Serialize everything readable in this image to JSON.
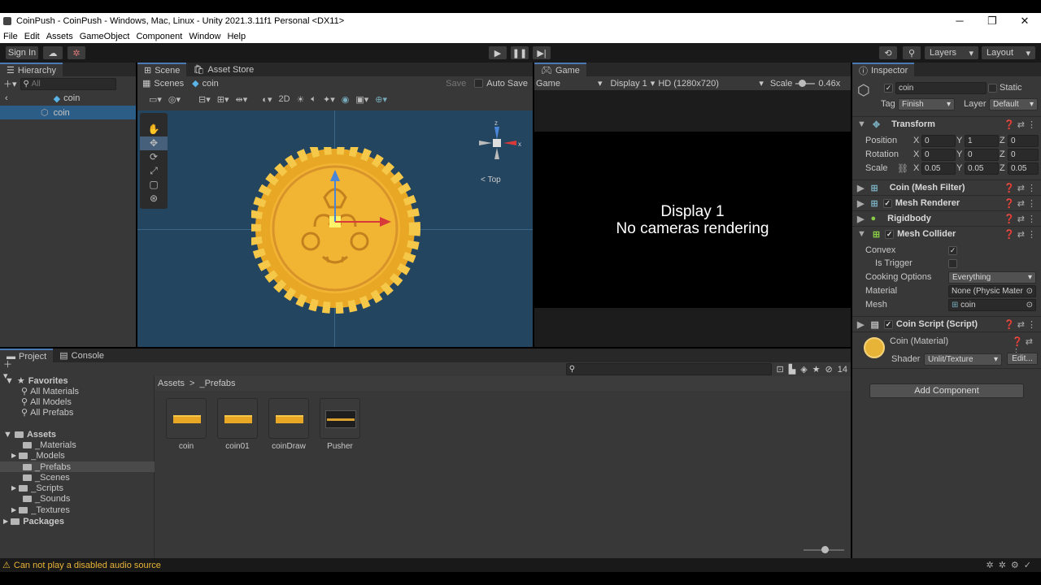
{
  "window": {
    "title": "CoinPush - CoinPush - Windows, Mac, Linux - Unity 2021.3.11f1 Personal <DX11>",
    "minimize": "─",
    "maximize": "❐",
    "close": "✕"
  },
  "menu": [
    "File",
    "Edit",
    "Assets",
    "GameObject",
    "Component",
    "Window",
    "Help"
  ],
  "toolbar": {
    "sign_in": "Sign In",
    "layers": "Layers",
    "layout": "Layout"
  },
  "hierarchy": {
    "tab": "Hierarchy",
    "search_placeholder": "All",
    "root": "coin",
    "child": "coin"
  },
  "scene": {
    "tab_scene": "Scene",
    "tab_asset_store": "Asset Store",
    "breadcrumb_scenes": "Scenes",
    "breadcrumb_object": "coin",
    "save": "Save",
    "auto_save": "Auto Save",
    "mode_2d": "2D",
    "gizmo_view": "Top",
    "axis_z": "z",
    "axis_x": "x"
  },
  "game": {
    "tab": "Game",
    "view": "Game",
    "display": "Display 1",
    "resolution": "HD (1280x720)",
    "scale_label": "Scale",
    "scale_value": "0.46x",
    "message_line1": "Display 1",
    "message_line2": "No cameras rendering"
  },
  "inspector": {
    "tab": "Inspector",
    "object_name": "coin",
    "static": "Static",
    "tag_label": "Tag",
    "tag_value": "Finish",
    "layer_label": "Layer",
    "layer_value": "Default",
    "transform": {
      "title": "Transform",
      "position_label": "Position",
      "rotation_label": "Rotation",
      "scale_label": "Scale",
      "position": {
        "x": "0",
        "y": "1",
        "z": "0"
      },
      "rotation": {
        "x": "0",
        "y": "0",
        "z": "0"
      },
      "scale": {
        "x": "0.05",
        "y": "0.05",
        "z": "0.05"
      }
    },
    "mesh_filter": "Coin (Mesh Filter)",
    "mesh_renderer": "Mesh Renderer",
    "rigidbody": "Rigidbody",
    "mesh_collider": {
      "title": "Mesh Collider",
      "convex_label": "Convex",
      "is_trigger_label": "Is Trigger",
      "cooking_label": "Cooking Options",
      "cooking_value": "Everything",
      "material_label": "Material",
      "material_value": "None (Physic Mater",
      "mesh_label": "Mesh",
      "mesh_value": "coin"
    },
    "coin_script": "Coin Script (Script)",
    "material": {
      "name": "Coin (Material)",
      "shader_label": "Shader",
      "shader_value": "Unlit/Texture",
      "edit": "Edit..."
    },
    "add_component": "Add Component"
  },
  "project": {
    "tab_project": "Project",
    "tab_console": "Console",
    "hidden_count": "14",
    "favorites": "Favorites",
    "fav_items": [
      "All Materials",
      "All Models",
      "All Prefabs"
    ],
    "assets": "Assets",
    "folders": [
      "_Materials",
      "_Models",
      "_Prefabs",
      "_Scenes",
      "_Scripts",
      "_Sounds",
      "_Textures"
    ],
    "packages": "Packages",
    "breadcrumb_root": "Assets",
    "breadcrumb_sep": ">",
    "breadcrumb_current": "_Prefabs",
    "items": [
      "coin",
      "coin01",
      "coinDraw",
      "Pusher"
    ]
  },
  "status": {
    "message": "Can not play a disabled audio source"
  }
}
